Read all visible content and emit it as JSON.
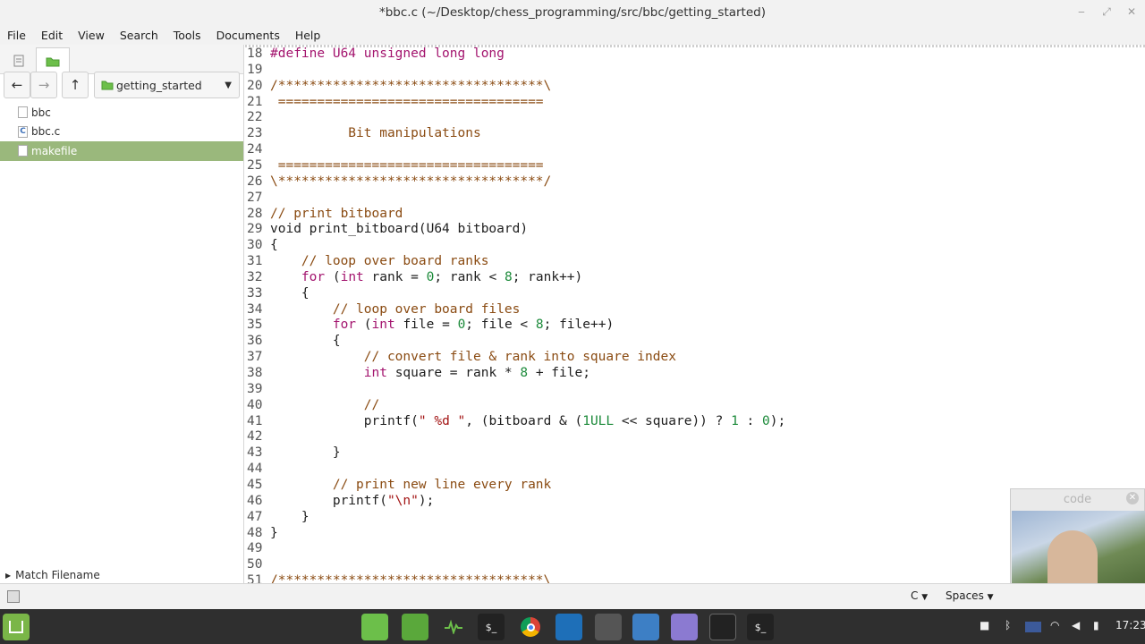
{
  "window": {
    "title": "*bbc.c (~/Desktop/chess_programming/src/bbc/getting_started)",
    "minimize": "‒",
    "maximize": "⤢",
    "close": "✕"
  },
  "menu": [
    "File",
    "Edit",
    "View",
    "Search",
    "Tools",
    "Documents",
    "Help"
  ],
  "sidebar": {
    "folder": "getting_started",
    "files": [
      {
        "name": "bbc",
        "icon": ""
      },
      {
        "name": "bbc.c",
        "icon": "C"
      },
      {
        "name": "makefile",
        "icon": "",
        "selected": true
      }
    ],
    "match_filename": "Match Filename"
  },
  "editor": {
    "lines": [
      {
        "n": "18",
        "text": "#define U64 unsigned long long"
      },
      {
        "n": "19",
        "text": ""
      },
      {
        "n": "20",
        "text": "/**********************************\\"
      },
      {
        "n": "21",
        "text": " =================================="
      },
      {
        "n": "22",
        "text": ""
      },
      {
        "n": "23",
        "text": "          Bit manipulations"
      },
      {
        "n": "24",
        "text": ""
      },
      {
        "n": "25",
        "text": " =================================="
      },
      {
        "n": "26",
        "text": "\\**********************************/"
      },
      {
        "n": "27",
        "text": ""
      },
      {
        "n": "28",
        "text": "// print bitboard"
      },
      {
        "n": "29",
        "text": "void print_bitboard(U64 bitboard)"
      },
      {
        "n": "30",
        "text": "{"
      },
      {
        "n": "31",
        "text": "    // loop over board ranks"
      },
      {
        "n": "32",
        "text": "    for (int rank = 0; rank < 8; rank++)"
      },
      {
        "n": "33",
        "text": "    {"
      },
      {
        "n": "34",
        "text": "        // loop over board files"
      },
      {
        "n": "35",
        "text": "        for (int file = 0; file < 8; file++)"
      },
      {
        "n": "36",
        "text": "        {"
      },
      {
        "n": "37",
        "text": "            // convert file & rank into square index"
      },
      {
        "n": "38",
        "text": "            int square = rank * 8 + file;"
      },
      {
        "n": "39",
        "text": ""
      },
      {
        "n": "40",
        "text": "            //"
      },
      {
        "n": "41",
        "text": "            printf(\" %d \", (bitboard & (1ULL << square)) ? 1 : 0);"
      },
      {
        "n": "42",
        "text": ""
      },
      {
        "n": "43",
        "text": "        }"
      },
      {
        "n": "44",
        "text": ""
      },
      {
        "n": "45",
        "text": "        // print new line every rank"
      },
      {
        "n": "46",
        "text": "        printf(\"\\n\");"
      },
      {
        "n": "47",
        "text": "    }"
      },
      {
        "n": "48",
        "text": "}"
      },
      {
        "n": "49",
        "text": ""
      },
      {
        "n": "50",
        "text": ""
      },
      {
        "n": "51",
        "text": "/**********************************\\"
      }
    ]
  },
  "status": {
    "language": "C",
    "indent": "Spaces"
  },
  "webcam": {
    "title": "code"
  },
  "tray": {
    "time": "17:23"
  },
  "colors": {
    "selection": "#9ab87c",
    "panel": "#2f2f2f",
    "comment": "#8a4b12",
    "keyword": "#a3146e",
    "number": "#1c8a3a"
  }
}
